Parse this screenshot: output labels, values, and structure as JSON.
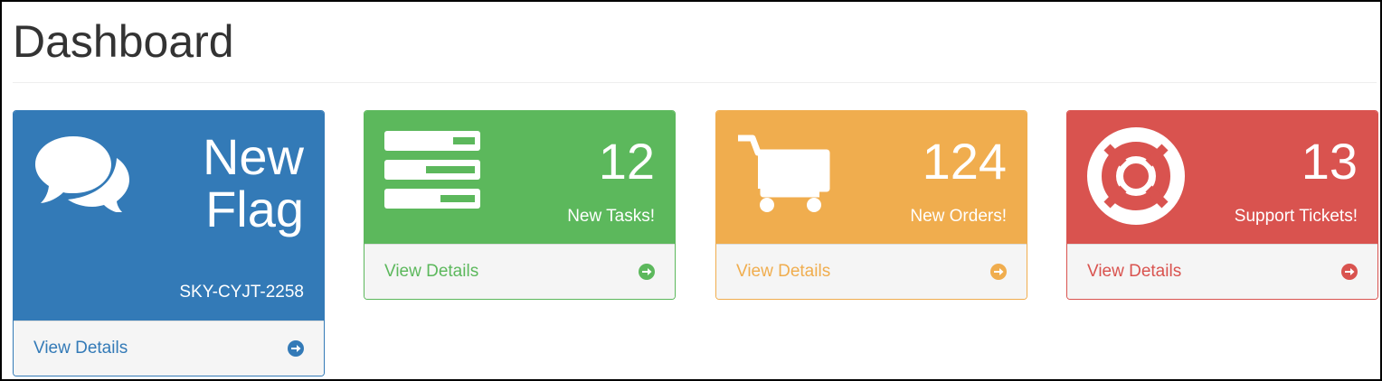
{
  "page": {
    "title": "Dashboard"
  },
  "panels": [
    {
      "id": "flag",
      "icon": "comments-icon",
      "big_line1": "New",
      "big_line2": "Flag",
      "subtitle": "SKY-CYJT-2258",
      "link_label": "View Details",
      "color": "#337ab7"
    },
    {
      "id": "tasks",
      "icon": "tasks-icon",
      "count": "12",
      "subtitle": "New Tasks!",
      "link_label": "View Details",
      "color": "#5cb85c"
    },
    {
      "id": "orders",
      "icon": "shopping-cart-icon",
      "count": "124",
      "subtitle": "New Orders!",
      "link_label": "View Details",
      "color": "#f0ad4e"
    },
    {
      "id": "tickets",
      "icon": "life-ring-icon",
      "count": "13",
      "subtitle": "Support Tickets!",
      "link_label": "View Details",
      "color": "#d9534f"
    }
  ]
}
